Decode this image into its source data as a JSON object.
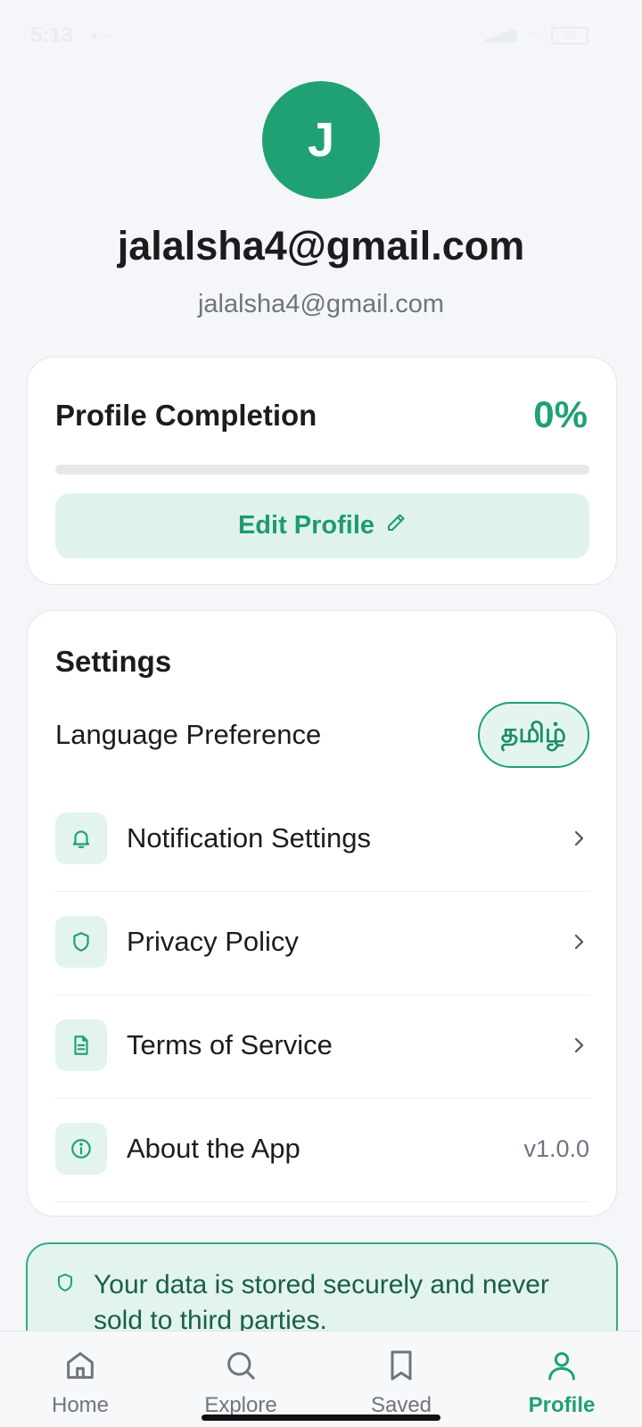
{
  "status_bar": {
    "time": "5:13",
    "battery": "59"
  },
  "profile": {
    "avatar_initial": "J",
    "display_name": "jalalsha4@gmail.com",
    "email": "jalalsha4@gmail.com"
  },
  "completion": {
    "title": "Profile Completion",
    "percent_label": "0%",
    "progress_fraction": 0,
    "edit_label": "Edit Profile"
  },
  "settings": {
    "title": "Settings",
    "language_label": "Language Preference",
    "language_value": "தமிழ்",
    "items": [
      {
        "label": "Notification Settings",
        "icon": "bell-icon"
      },
      {
        "label": "Privacy Policy",
        "icon": "shield-icon"
      },
      {
        "label": "Terms of Service",
        "icon": "document-icon"
      },
      {
        "label": "About the App",
        "icon": "info-icon",
        "value": "v1.0.0"
      }
    ]
  },
  "notice": {
    "text": "Your data is stored securely and never sold to third parties."
  },
  "nav": {
    "items": [
      {
        "label": "Home",
        "icon": "home-icon"
      },
      {
        "label": "Explore",
        "icon": "search-icon"
      },
      {
        "label": "Saved",
        "icon": "bookmark-icon"
      },
      {
        "label": "Profile",
        "icon": "person-icon",
        "active": true
      }
    ]
  },
  "colors": {
    "accent": "#1fa174",
    "accent_light": "#dff3ec",
    "background": "#f4f6f9"
  }
}
